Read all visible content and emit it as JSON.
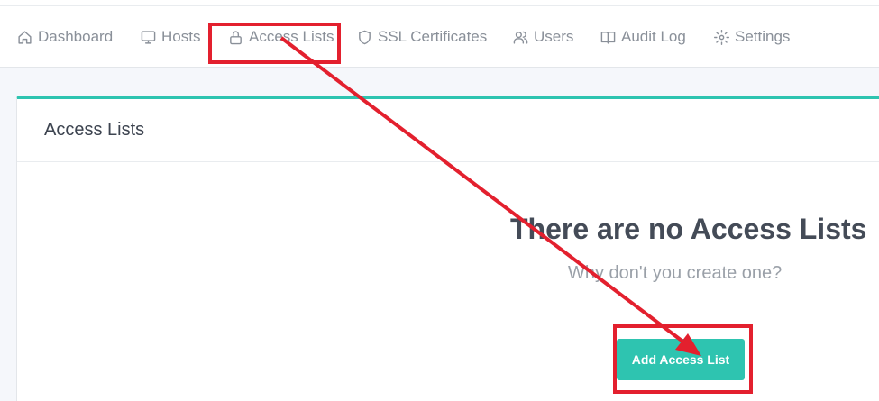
{
  "nav": {
    "items": [
      {
        "label": "Dashboard",
        "icon": "home-icon"
      },
      {
        "label": "Hosts",
        "icon": "monitor-icon"
      },
      {
        "label": "Access Lists",
        "icon": "lock-icon"
      },
      {
        "label": "SSL Certificates",
        "icon": "shield-icon"
      },
      {
        "label": "Users",
        "icon": "users-icon"
      },
      {
        "label": "Audit Log",
        "icon": "book-icon"
      },
      {
        "label": "Settings",
        "icon": "gear-icon"
      }
    ]
  },
  "card": {
    "title": "Access Lists",
    "empty_title": "There are no Access Lists",
    "empty_subtitle": "Why don't you create one?",
    "add_button_label": "Add Access List"
  },
  "colors": {
    "accent": "#2ec4b0",
    "annotation": "#e3202e",
    "nav_text": "#8a9099"
  }
}
